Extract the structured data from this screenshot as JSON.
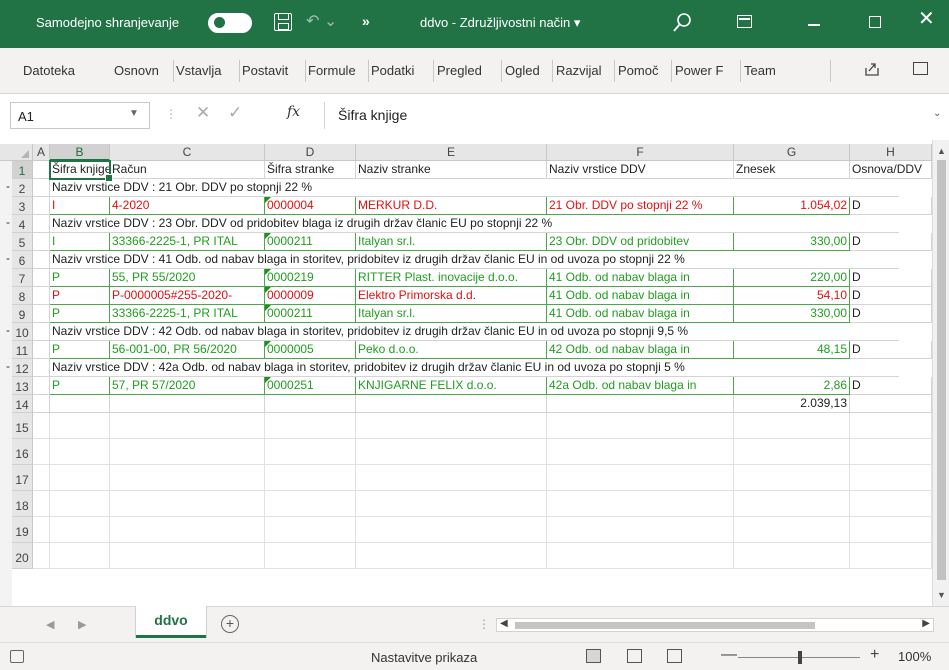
{
  "titlebar": {
    "autosave_label": "Samodejno shranjevanje",
    "doc_title": "ddvo  -  Združljivostni način  ▾"
  },
  "ribbon": {
    "tabs": [
      "Datoteka",
      "Osnovn",
      "Vstavlja",
      "Postavit",
      "Formule",
      "Podatki",
      "Pregled",
      "Ogled",
      "Razvijal",
      "Pomoč",
      "Power F",
      "Team"
    ]
  },
  "formula_bar": {
    "name_box": "A1",
    "fx": "fx",
    "formula": "Šifra knjige"
  },
  "columns": [
    "A",
    "B",
    "C",
    "D",
    "E",
    "F",
    "G",
    "H"
  ],
  "header_row": {
    "b": "Šifra knjige",
    "c": "Račun",
    "d": "Šifra stranke",
    "e": "Naziv stranke",
    "f": "Naziv vrstice DDV",
    "g": "Znesek",
    "h": "Osnova/DDV"
  },
  "rows": [
    {
      "num": "1"
    },
    {
      "num": "2",
      "group": "Naziv vrstice DDV : 21 Obr. DDV po stopnji 22 %"
    },
    {
      "num": "3",
      "color": "red",
      "b": "I",
      "c": "4-2020",
      "d": "0000004",
      "e": "MERKUR D.D.",
      "f": "21 Obr. DDV po stopnji 22 %",
      "g": "1.054,02",
      "h": "D"
    },
    {
      "num": "4",
      "group": "Naziv vrstice DDV : 23 Obr. DDV od pridobitev blaga iz drugih držav članic EU po stopnji 22 %"
    },
    {
      "num": "5",
      "color": "green",
      "b": "I",
      "c": "33366-2225-1, PR ITAL",
      "d": "0000211",
      "e": "Italyan sr.l.",
      "f": "23 Obr. DDV od pridobitev",
      "g": "330,00",
      "h": "D"
    },
    {
      "num": "6",
      "group": "Naziv vrstice DDV : 41 Odb. od nabav blaga in storitev, pridobitev iz drugih držav članic EU in od uvoza po stopnji 22 %"
    },
    {
      "num": "7",
      "color": "green",
      "b": "P",
      "c": "55, PR 55/2020",
      "d": "0000219",
      "e": "RITTER Plast. inovacije d.o.o.",
      "f": "41 Odb. od nabav blaga in",
      "g": "220,00",
      "h": "D"
    },
    {
      "num": "8",
      "color": "red",
      "b": "P",
      "c": "P-0000005#255-2020-",
      "d": "0000009",
      "e": "Elektro Primorska d.d.",
      "f": "41 Odb. od nabav blaga in",
      "g": "54,10",
      "h": "D"
    },
    {
      "num": "9",
      "color": "green",
      "b": "P",
      "c": "33366-2225-1, PR ITAL",
      "d": "0000211",
      "e": "Italyan sr.l.",
      "f": "41 Odb. od nabav blaga in",
      "g": "330,00",
      "h": "D"
    },
    {
      "num": "10",
      "group": "Naziv vrstice DDV : 42 Odb. od nabav blaga in storitev, pridobitev iz drugih držav članic EU in od uvoza po stopnji 9,5 %"
    },
    {
      "num": "11",
      "color": "green",
      "b": "P",
      "c": "56-001-00, PR 56/2020",
      "d": "0000005",
      "e": "Peko d.o.o.",
      "f": "42 Odb. od nabav blaga in",
      "g": "48,15",
      "h": "D"
    },
    {
      "num": "12",
      "group": "Naziv vrstice DDV : 42a Odb. od nabav blaga in storitev, pridobitev iz drugih držav članic EU in od uvoza po stopnji 5 %"
    },
    {
      "num": "13",
      "color": "green",
      "b": "P",
      "c": "57, PR 57/2020",
      "d": "0000251",
      "e": "KNJIGARNE FELIX d.o.o.",
      "f": "42a Odb. od nabav blaga in",
      "g": "2,86",
      "h": "D"
    },
    {
      "num": "14",
      "total": "2.039,13"
    },
    {
      "num": "15"
    },
    {
      "num": "16"
    },
    {
      "num": "17"
    },
    {
      "num": "18"
    },
    {
      "num": "19"
    },
    {
      "num": "20"
    }
  ],
  "group_marker": "-",
  "sheet_tab": "ddvo",
  "status": {
    "display_settings": "Nastavitve prikaza",
    "zoom": "100%"
  },
  "colors": {
    "accent": "#217346",
    "green_text": "#1f9d1f",
    "red_text": "#e01010"
  },
  "icons": [
    "toggle-icon",
    "save-icon",
    "undo-icon",
    "search-icon",
    "ribbon-display-icon",
    "minimize-icon",
    "maximize-icon",
    "close-icon",
    "share-icon",
    "comments-icon",
    "cancel-icon",
    "enter-icon",
    "fx-icon",
    "add-sheet-icon",
    "macro-icon"
  ]
}
